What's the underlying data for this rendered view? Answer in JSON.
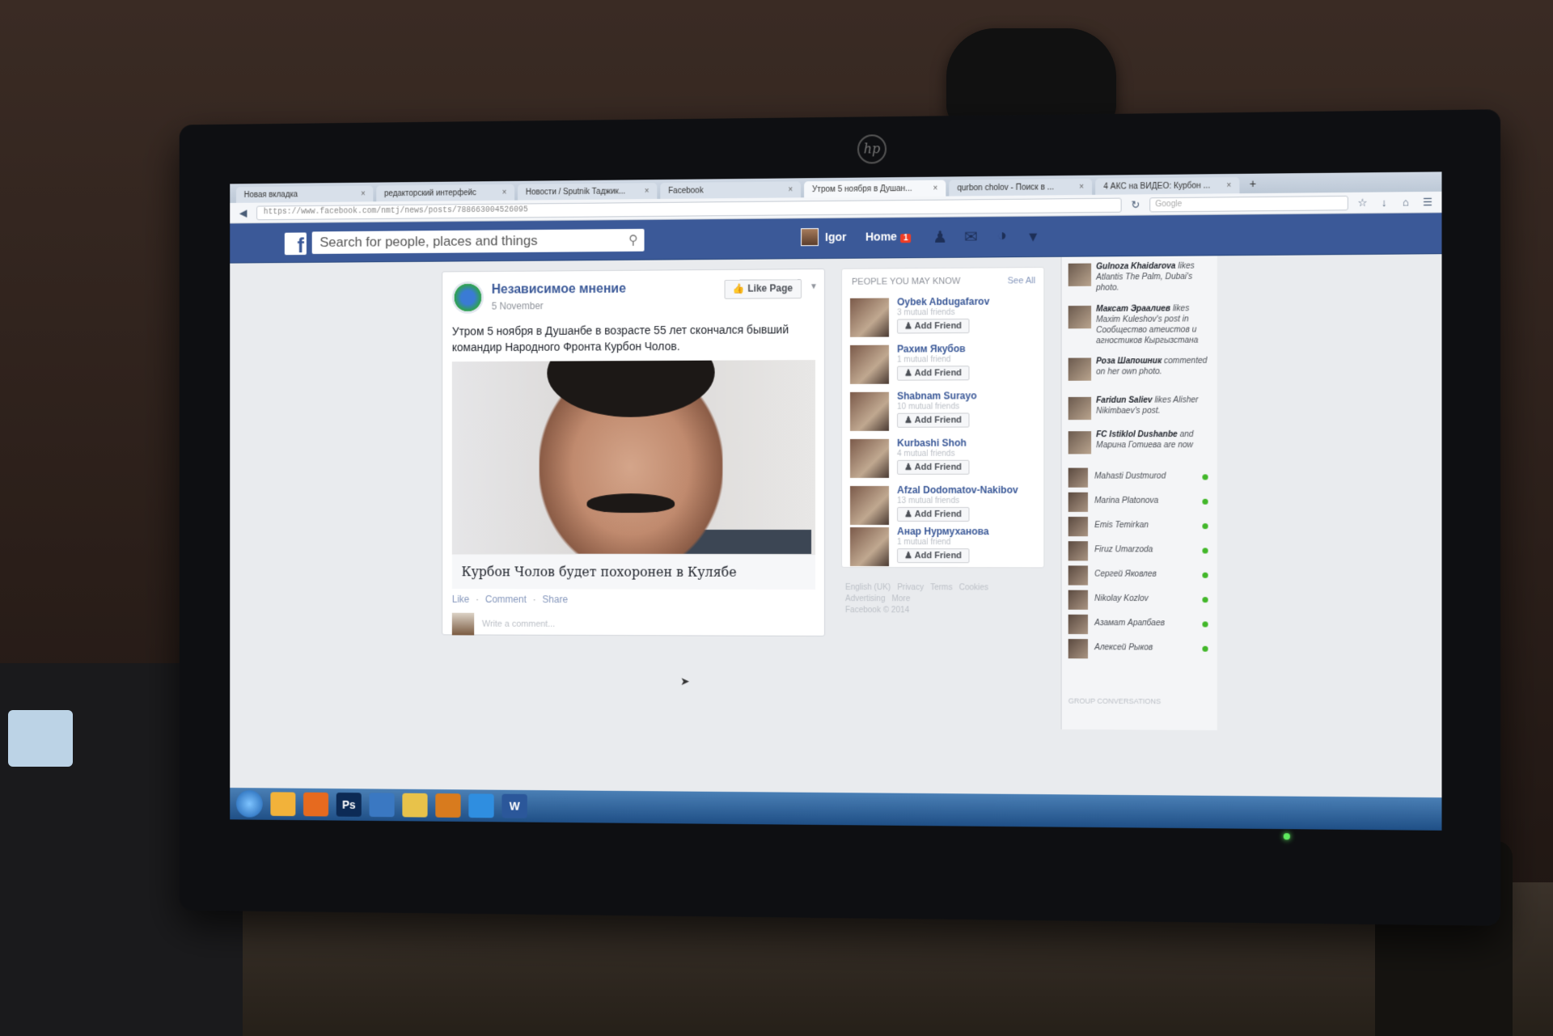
{
  "browser": {
    "tabs": [
      {
        "label": "Новая вкладка",
        "active": false
      },
      {
        "label": "редакторский интерфейс",
        "active": false
      },
      {
        "label": "Новости / Sputnik Таджик...",
        "active": false
      },
      {
        "label": "Facebook",
        "active": false
      },
      {
        "label": "Утром 5 ноября в Душан...",
        "active": true
      },
      {
        "label": "qurbon cholov - Поиск в ...",
        "active": false
      },
      {
        "label": "4 АКС на ВИДЕО: Курбон ...",
        "active": false
      }
    ],
    "new_tab": "+",
    "close_glyph": "×",
    "url": "https://www.facebook.com/nmtj/news/posts/788663004526095",
    "search_placeholder": "Google"
  },
  "fb": {
    "logo": "f",
    "search_placeholder": "Search for people, places and things",
    "user_name": "Igor",
    "home_label": "Home",
    "home_badge": "1"
  },
  "post": {
    "page_name": "Независимое мнение",
    "date": "5 November",
    "like_page_label": "Like Page",
    "text": "Утром 5 ноября в Душанбе в возрасте 55 лет скончался бывший командир Народного Фронта Курбон Чолов.",
    "link_title": "Курбон Чолов будет похоронен в Кулябе",
    "actions": [
      "Like",
      "Comment",
      "Share"
    ],
    "comment_placeholder": "Write a comment..."
  },
  "pymk": {
    "heading": "PEOPLE YOU MAY KNOW",
    "see_all": "See All",
    "add_label": "Add Friend",
    "people": [
      {
        "name": "Oybek Abdugafarov",
        "mutual": "3 mutual friends"
      },
      {
        "name": "Рахим Якубов",
        "mutual": "1 mutual friend"
      },
      {
        "name": "Shabnam Surayo",
        "mutual": "10 mutual friends"
      },
      {
        "name": "Kurbashi Shoh",
        "mutual": "4 mutual friends"
      },
      {
        "name": "Afzal Dodomatov-Nakibov",
        "mutual": "13 mutual friends"
      },
      {
        "name": "Анар Нурмуханова",
        "mutual": "1 mutual friend"
      }
    ]
  },
  "footer": {
    "links": [
      "English (UK)",
      "Privacy",
      "Terms",
      "Cookies",
      "Advertising",
      "More"
    ],
    "copyright": "Facebook © 2014"
  },
  "ticker": [
    {
      "name": "Gulnoza Khaidarova",
      "text": "likes Atlantis The Palm, Dubai's photo."
    },
    {
      "name": "Максат Эраалиев",
      "text": "likes Maxim Kuleshov's post in Сообщество атеистов и агностиков Кыргызстана"
    },
    {
      "name": "Роза Шапошник",
      "text": "commented on her own photo."
    },
    {
      "name": "Faridun Saliev",
      "text": "likes Alisher Nikimbaev's post."
    },
    {
      "name": "FC Istiklol Dushanbe",
      "text": "and Марина Готиева are now"
    }
  ],
  "chat": [
    "Mahasti Dustmurod",
    "Marina Platonova",
    "Emis Temirkan",
    "Firuz Umarzoda",
    "Сергей Яковлев",
    "Nikolay Kozlov",
    "Азамат Арапбаев",
    "Алексей Рыков"
  ],
  "chat_group_heading": "GROUP CONVERSATIONS",
  "taskbar": {
    "apps": [
      "Ps",
      "W"
    ]
  },
  "hardware": {
    "brand": "hp"
  },
  "colors": {
    "fb_blue": "#3b5998",
    "link": "#3b5998",
    "online": "#42b72a"
  }
}
